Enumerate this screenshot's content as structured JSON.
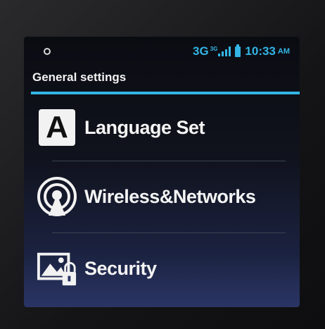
{
  "status_bar": {
    "network": "3G",
    "network_sup": "3G",
    "time": "10:33",
    "ampm": "AM",
    "accent_color": "#33b5e5",
    "left_icon": "location-dot-icon"
  },
  "header": {
    "title": "General settings"
  },
  "menu": {
    "items": [
      {
        "label": "Language Set",
        "icon": "language-a-icon",
        "icon_text": "A"
      },
      {
        "label": "Wireless&Networks",
        "icon": "wireless-broadcast-icon"
      },
      {
        "label": "Security",
        "icon": "security-lock-image-icon"
      }
    ]
  }
}
